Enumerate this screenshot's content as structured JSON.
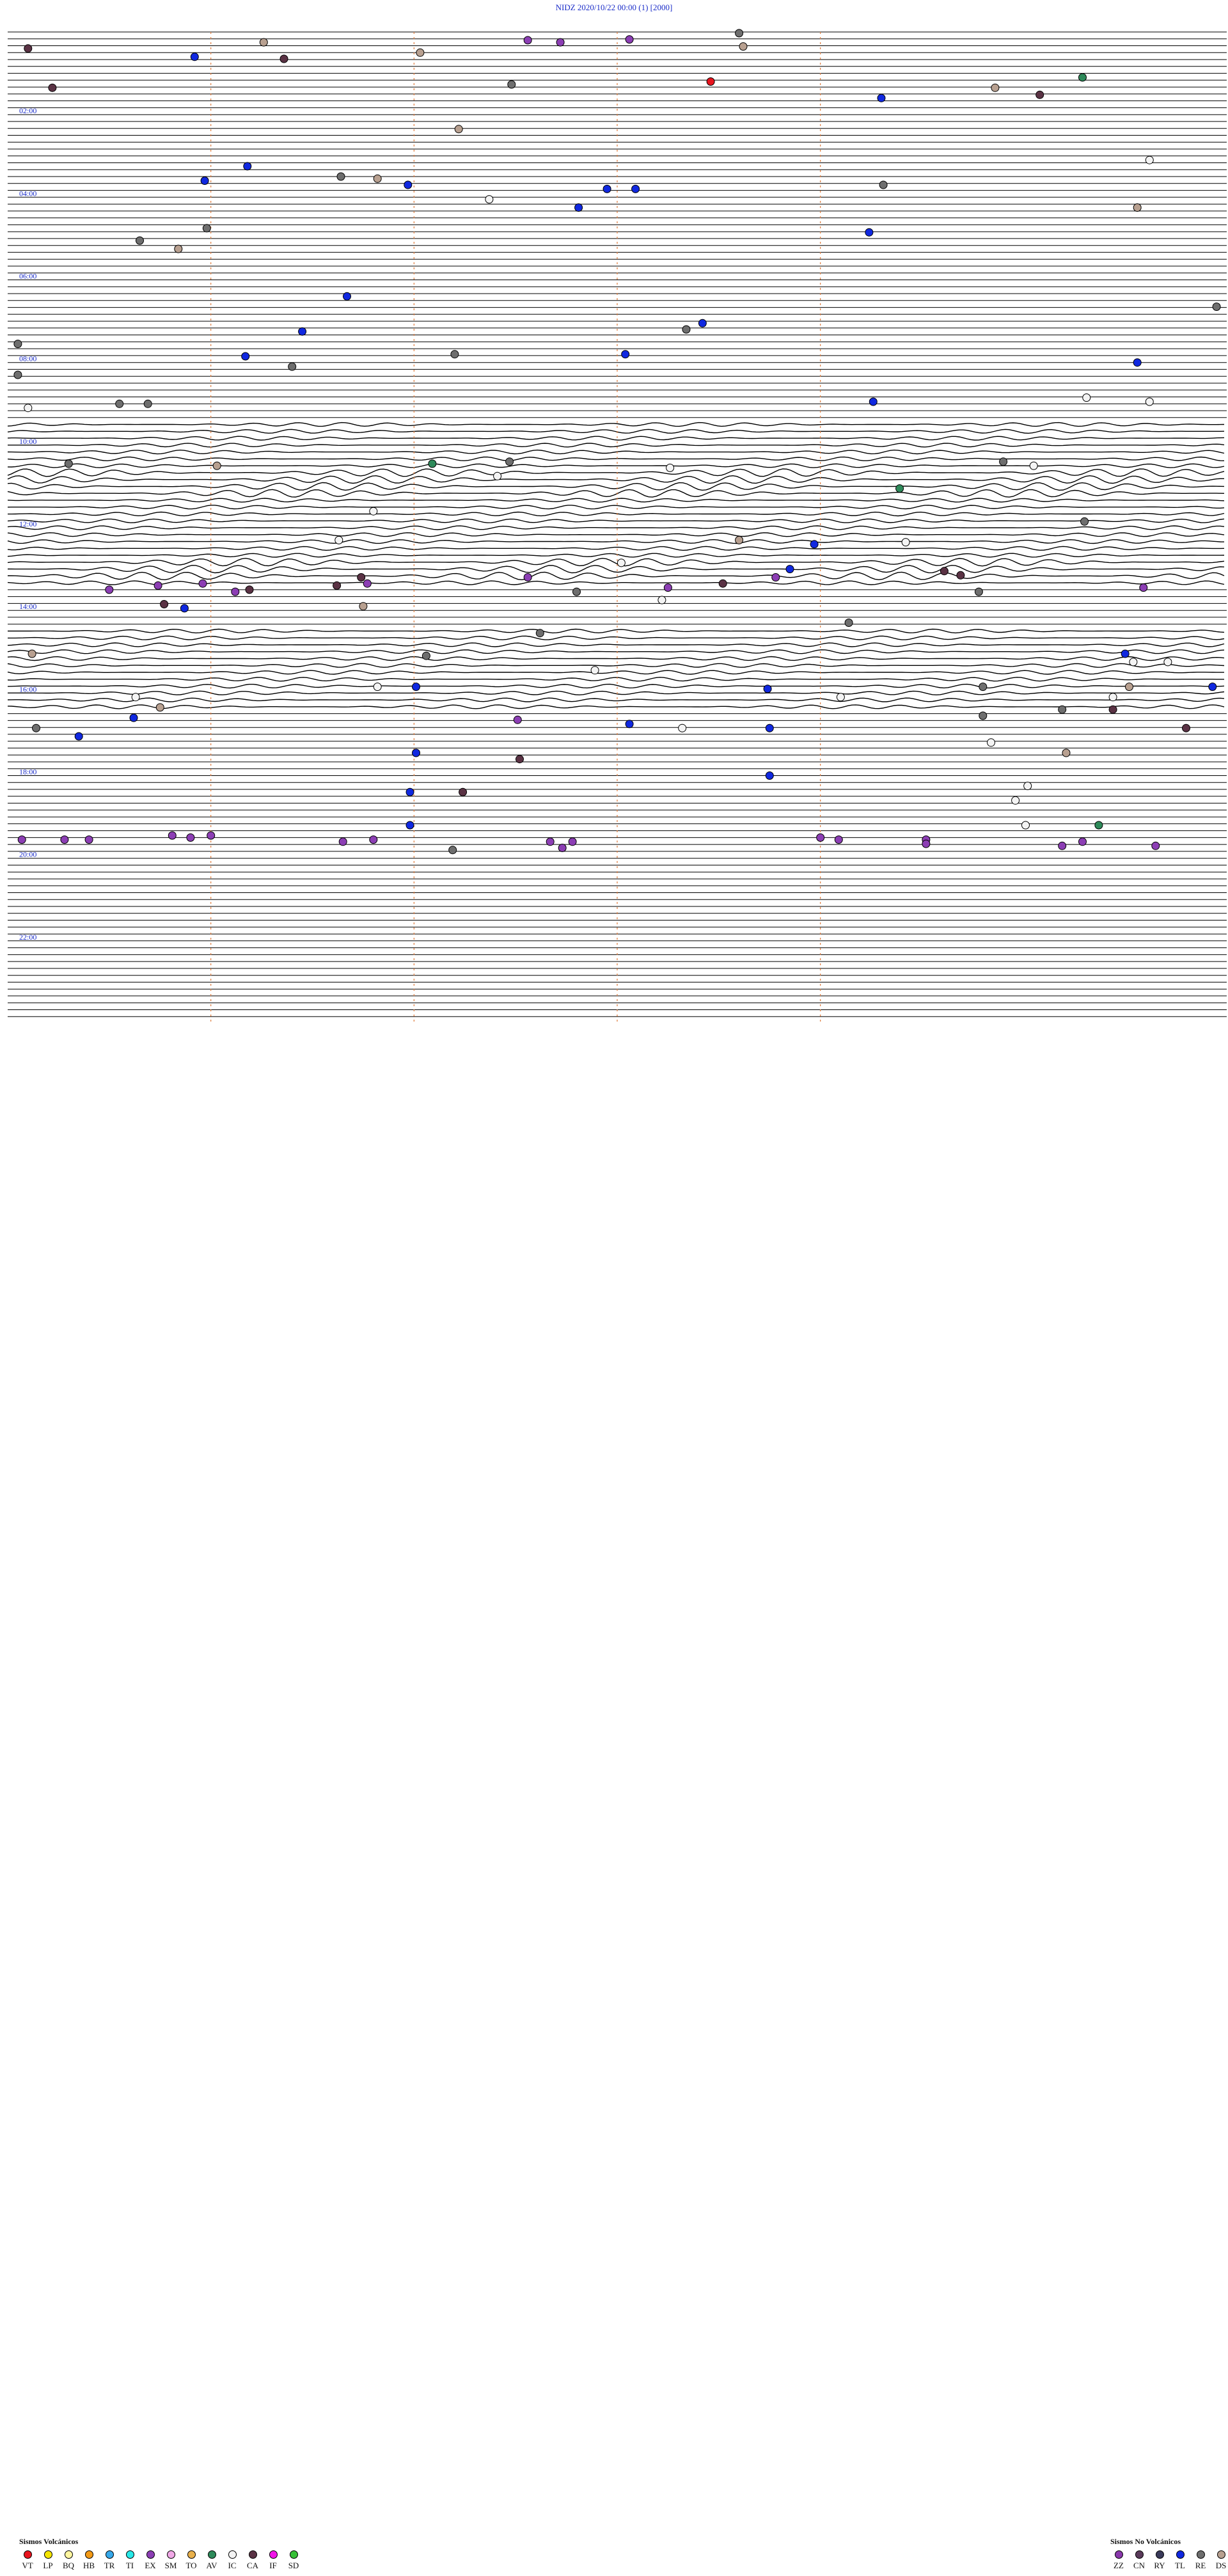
{
  "header": {
    "title": "NIDZ    2020/10/22 00:00      (1)   [2000]"
  },
  "chart_data": {
    "type": "scatter",
    "title": "NIDZ    2020/10/22 00:00      (1)   [2000]",
    "station": "NIDZ",
    "date": "2020/10/22 00:00",
    "hour_labels": [
      "02:00",
      "04:00",
      "06:00",
      "08:00",
      "10:00",
      "12:00",
      "14:00",
      "16:00",
      "18:00",
      "20:00",
      "22:00"
    ],
    "x_range_minutes": [
      0,
      60
    ],
    "y_range_hours": [
      0,
      24
    ],
    "trace_lines_per_hour": 6,
    "minute_dividers": [
      10,
      20,
      30,
      40
    ],
    "colors": {
      "VT": "#e8141e",
      "LP": "#f4e400",
      "BQ": "#fff6a0",
      "HB": "#f39a16",
      "TR": "#36a8ea",
      "TI": "#28e8e8",
      "EX": "#8c3eb4",
      "SM": "#f0a8e6",
      "TO": "#e8b04c",
      "AV": "#2e8a5a",
      "IC": "#f4f4f4",
      "CA": "#5a3244",
      "IF": "#f014e8",
      "SD": "#38c038",
      "ZZ": "#8a38ac",
      "CN": "#5a3a5a",
      "RY": "#3a3a5a",
      "TL": "#1028e0",
      "RE": "#6e6e6e",
      "DS": "#b8a090",
      "trace": "#000000",
      "divider": "#e07c3c",
      "label": "#1a2cc8"
    },
    "legend_volcanic": {
      "title": "Sismos Volcánicos",
      "items": [
        "VT",
        "LP",
        "BQ",
        "HB",
        "TR",
        "TI",
        "EX",
        "SM",
        "TO",
        "AV",
        "IC",
        "CA",
        "IF",
        "SD"
      ]
    },
    "legend_non_volcanic": {
      "title": "Sismos No Volcánicos",
      "items": [
        "ZZ",
        "CN",
        "RY",
        "TL",
        "RE",
        "DS"
      ]
    },
    "events": [
      {
        "minute": 1.0,
        "hour": 0.4,
        "type": "CA"
      },
      {
        "minute": 12.6,
        "hour": 0.25,
        "type": "DS"
      },
      {
        "minute": 9.2,
        "hour": 0.6,
        "type": "TL"
      },
      {
        "minute": 13.6,
        "hour": 0.65,
        "type": "CA"
      },
      {
        "minute": 20.3,
        "hour": 0.5,
        "type": "DS"
      },
      {
        "minute": 25.6,
        "hour": 0.2,
        "type": "EX"
      },
      {
        "minute": 27.2,
        "hour": 0.25,
        "type": "EX"
      },
      {
        "minute": 30.6,
        "hour": 0.18,
        "type": "EX"
      },
      {
        "minute": 36.0,
        "hour": 0.03,
        "type": "RE"
      },
      {
        "minute": 36.2,
        "hour": 0.35,
        "type": "DS"
      },
      {
        "minute": 34.6,
        "hour": 1.2,
        "type": "VT"
      },
      {
        "minute": 24.8,
        "hour": 1.27,
        "type": "RE"
      },
      {
        "minute": 2.2,
        "hour": 1.35,
        "type": "CA"
      },
      {
        "minute": 43.0,
        "hour": 1.6,
        "type": "TL"
      },
      {
        "minute": 48.6,
        "hour": 1.35,
        "type": "DS"
      },
      {
        "minute": 50.8,
        "hour": 1.52,
        "type": "CA"
      },
      {
        "minute": 52.9,
        "hour": 1.1,
        "type": "AV"
      },
      {
        "minute": 22.2,
        "hour": 2.35,
        "type": "DS"
      },
      {
        "minute": 11.8,
        "hour": 3.25,
        "type": "TL"
      },
      {
        "minute": 16.4,
        "hour": 3.5,
        "type": "RE"
      },
      {
        "minute": 18.2,
        "hour": 3.55,
        "type": "DS"
      },
      {
        "minute": 9.7,
        "hour": 3.6,
        "type": "TL"
      },
      {
        "minute": 19.7,
        "hour": 3.7,
        "type": "TL"
      },
      {
        "minute": 29.5,
        "hour": 3.8,
        "type": "TL"
      },
      {
        "minute": 30.9,
        "hour": 3.8,
        "type": "TL"
      },
      {
        "minute": 43.1,
        "hour": 3.7,
        "type": "RE"
      },
      {
        "minute": 56.2,
        "hour": 3.1,
        "type": "IC"
      },
      {
        "minute": 23.7,
        "hour": 4.05,
        "type": "IC"
      },
      {
        "minute": 28.1,
        "hour": 4.25,
        "type": "TL"
      },
      {
        "minute": 55.6,
        "hour": 4.25,
        "type": "DS"
      },
      {
        "minute": 9.8,
        "hour": 4.75,
        "type": "RE"
      },
      {
        "minute": 6.5,
        "hour": 5.05,
        "type": "RE"
      },
      {
        "minute": 8.4,
        "hour": 5.25,
        "type": "DS"
      },
      {
        "minute": 42.4,
        "hour": 4.85,
        "type": "TL"
      },
      {
        "minute": 16.7,
        "hour": 6.4,
        "type": "TL"
      },
      {
        "minute": 59.5,
        "hour": 6.65,
        "type": "RE"
      },
      {
        "minute": 34.2,
        "hour": 7.05,
        "type": "TL"
      },
      {
        "minute": 14.5,
        "hour": 7.25,
        "type": "TL"
      },
      {
        "minute": 33.4,
        "hour": 7.2,
        "type": "RE"
      },
      {
        "minute": 0.5,
        "hour": 7.55,
        "type": "RE"
      },
      {
        "minute": 22.0,
        "hour": 7.8,
        "type": "RE"
      },
      {
        "minute": 11.7,
        "hour": 7.85,
        "type": "TL"
      },
      {
        "minute": 14.0,
        "hour": 8.1,
        "type": "RE"
      },
      {
        "minute": 30.4,
        "hour": 7.8,
        "type": "TL"
      },
      {
        "minute": 55.6,
        "hour": 8.0,
        "type": "TL"
      },
      {
        "minute": 0.5,
        "hour": 8.3,
        "type": "RE"
      },
      {
        "minute": 1.0,
        "hour": 9.1,
        "type": "IC"
      },
      {
        "minute": 42.6,
        "hour": 8.95,
        "type": "TL"
      },
      {
        "minute": 53.1,
        "hour": 8.85,
        "type": "IC"
      },
      {
        "minute": 56.2,
        "hour": 8.95,
        "type": "IC"
      },
      {
        "minute": 5.5,
        "hour": 9.0,
        "type": "RE"
      },
      {
        "minute": 6.9,
        "hour": 9.0,
        "type": "RE"
      },
      {
        "minute": 3.0,
        "hour": 10.45,
        "type": "RE"
      },
      {
        "minute": 10.3,
        "hour": 10.5,
        "type": "DS"
      },
      {
        "minute": 20.9,
        "hour": 10.45,
        "type": "AV"
      },
      {
        "minute": 24.7,
        "hour": 10.4,
        "type": "RE"
      },
      {
        "minute": 24.1,
        "hour": 10.75,
        "type": "IC"
      },
      {
        "minute": 32.6,
        "hour": 10.55,
        "type": "IC"
      },
      {
        "minute": 49.0,
        "hour": 10.4,
        "type": "RE"
      },
      {
        "minute": 50.5,
        "hour": 10.5,
        "type": "IC"
      },
      {
        "minute": 43.9,
        "hour": 11.05,
        "type": "AV"
      },
      {
        "minute": 18.0,
        "hour": 11.6,
        "type": "IC"
      },
      {
        "minute": 53.0,
        "hour": 11.85,
        "type": "RE"
      },
      {
        "minute": 16.3,
        "hour": 12.3,
        "type": "IC"
      },
      {
        "minute": 36.0,
        "hour": 12.3,
        "type": "DS"
      },
      {
        "minute": 39.7,
        "hour": 12.4,
        "type": "TL"
      },
      {
        "minute": 44.2,
        "hour": 12.35,
        "type": "IC"
      },
      {
        "minute": 30.2,
        "hour": 12.85,
        "type": "IC"
      },
      {
        "minute": 38.5,
        "hour": 13.0,
        "type": "TL"
      },
      {
        "minute": 17.4,
        "hour": 13.2,
        "type": "CA"
      },
      {
        "minute": 7.4,
        "hour": 13.4,
        "type": "EX"
      },
      {
        "minute": 9.6,
        "hour": 13.35,
        "type": "EX"
      },
      {
        "minute": 16.2,
        "hour": 13.4,
        "type": "CA"
      },
      {
        "minute": 17.7,
        "hour": 13.35,
        "type": "EX"
      },
      {
        "minute": 5.0,
        "hour": 13.5,
        "type": "EX"
      },
      {
        "minute": 11.2,
        "hour": 13.55,
        "type": "EX"
      },
      {
        "minute": 11.9,
        "hour": 13.5,
        "type": "CA"
      },
      {
        "minute": 25.6,
        "hour": 13.2,
        "type": "EX"
      },
      {
        "minute": 28.0,
        "hour": 13.55,
        "type": "RE"
      },
      {
        "minute": 32.5,
        "hour": 13.45,
        "type": "EX"
      },
      {
        "minute": 35.2,
        "hour": 13.35,
        "type": "CA"
      },
      {
        "minute": 37.8,
        "hour": 13.2,
        "type": "EX"
      },
      {
        "minute": 46.1,
        "hour": 13.05,
        "type": "CA"
      },
      {
        "minute": 46.9,
        "hour": 13.15,
        "type": "CA"
      },
      {
        "minute": 47.8,
        "hour": 13.55,
        "type": "RE"
      },
      {
        "minute": 55.9,
        "hour": 13.45,
        "type": "EX"
      },
      {
        "minute": 7.7,
        "hour": 13.85,
        "type": "CA"
      },
      {
        "minute": 8.7,
        "hour": 13.95,
        "type": "TL"
      },
      {
        "minute": 17.5,
        "hour": 13.9,
        "type": "DS"
      },
      {
        "minute": 32.2,
        "hour": 13.75,
        "type": "IC"
      },
      {
        "minute": 41.4,
        "hour": 14.3,
        "type": "RE"
      },
      {
        "minute": 26.2,
        "hour": 14.55,
        "type": "RE"
      },
      {
        "minute": 1.2,
        "hour": 15.05,
        "type": "DS"
      },
      {
        "minute": 20.6,
        "hour": 15.1,
        "type": "RE"
      },
      {
        "minute": 55.0,
        "hour": 15.05,
        "type": "TL"
      },
      {
        "minute": 55.4,
        "hour": 15.25,
        "type": "IC"
      },
      {
        "minute": 57.1,
        "hour": 15.25,
        "type": "IC"
      },
      {
        "minute": 28.9,
        "hour": 15.45,
        "type": "IC"
      },
      {
        "minute": 37.4,
        "hour": 15.9,
        "type": "TL"
      },
      {
        "minute": 18.2,
        "hour": 15.85,
        "type": "IC"
      },
      {
        "minute": 20.1,
        "hour": 15.85,
        "type": "TL"
      },
      {
        "minute": 41.0,
        "hour": 16.1,
        "type": "IC"
      },
      {
        "minute": 48.0,
        "hour": 15.85,
        "type": "RE"
      },
      {
        "minute": 55.2,
        "hour": 15.85,
        "type": "DS"
      },
      {
        "minute": 59.3,
        "hour": 15.85,
        "type": "TL"
      },
      {
        "minute": 54.4,
        "hour": 16.1,
        "type": "IC"
      },
      {
        "minute": 51.9,
        "hour": 16.4,
        "type": "RE"
      },
      {
        "minute": 54.4,
        "hour": 16.4,
        "type": "CA"
      },
      {
        "minute": 6.3,
        "hour": 16.1,
        "type": "IC"
      },
      {
        "minute": 7.5,
        "hour": 16.35,
        "type": "DS"
      },
      {
        "minute": 6.2,
        "hour": 16.6,
        "type": "TL"
      },
      {
        "minute": 48.0,
        "hour": 16.55,
        "type": "RE"
      },
      {
        "minute": 25.1,
        "hour": 16.65,
        "type": "EX"
      },
      {
        "minute": 1.4,
        "hour": 16.85,
        "type": "RE"
      },
      {
        "minute": 30.6,
        "hour": 16.75,
        "type": "TL"
      },
      {
        "minute": 33.2,
        "hour": 16.85,
        "type": "IC"
      },
      {
        "minute": 37.5,
        "hour": 16.85,
        "type": "TL"
      },
      {
        "minute": 58.0,
        "hour": 16.85,
        "type": "CA"
      },
      {
        "minute": 3.5,
        "hour": 17.05,
        "type": "TL"
      },
      {
        "minute": 48.4,
        "hour": 17.2,
        "type": "IC"
      },
      {
        "minute": 52.1,
        "hour": 17.45,
        "type": "DS"
      },
      {
        "minute": 25.2,
        "hour": 17.6,
        "type": "CA"
      },
      {
        "minute": 20.1,
        "hour": 17.45,
        "type": "TL"
      },
      {
        "minute": 37.5,
        "hour": 18.0,
        "type": "TL"
      },
      {
        "minute": 50.2,
        "hour": 18.25,
        "type": "IC"
      },
      {
        "minute": 19.8,
        "hour": 18.4,
        "type": "TL"
      },
      {
        "minute": 22.4,
        "hour": 18.4,
        "type": "CA"
      },
      {
        "minute": 49.6,
        "hour": 18.6,
        "type": "IC"
      },
      {
        "minute": 0.7,
        "hour": 19.55,
        "type": "EX"
      },
      {
        "minute": 2.8,
        "hour": 19.55,
        "type": "EX"
      },
      {
        "minute": 4.0,
        "hour": 19.55,
        "type": "EX"
      },
      {
        "minute": 8.1,
        "hour": 19.45,
        "type": "EX"
      },
      {
        "minute": 9.0,
        "hour": 19.5,
        "type": "EX"
      },
      {
        "minute": 10.0,
        "hour": 19.45,
        "type": "EX"
      },
      {
        "minute": 16.5,
        "hour": 19.6,
        "type": "EX"
      },
      {
        "minute": 18.0,
        "hour": 19.55,
        "type": "EX"
      },
      {
        "minute": 19.8,
        "hour": 19.2,
        "type": "TL"
      },
      {
        "minute": 21.9,
        "hour": 19.8,
        "type": "RE"
      },
      {
        "minute": 26.7,
        "hour": 19.6,
        "type": "EX"
      },
      {
        "minute": 27.8,
        "hour": 19.6,
        "type": "EX"
      },
      {
        "minute": 27.3,
        "hour": 19.75,
        "type": "EX"
      },
      {
        "minute": 40.0,
        "hour": 19.5,
        "type": "EX"
      },
      {
        "minute": 40.9,
        "hour": 19.55,
        "type": "EX"
      },
      {
        "minute": 45.2,
        "hour": 19.55,
        "type": "EX"
      },
      {
        "minute": 45.2,
        "hour": 19.65,
        "type": "EX"
      },
      {
        "minute": 50.1,
        "hour": 19.2,
        "type": "IC"
      },
      {
        "minute": 53.7,
        "hour": 19.2,
        "type": "AV"
      },
      {
        "minute": 51.9,
        "hour": 19.7,
        "type": "EX"
      },
      {
        "minute": 52.9,
        "hour": 19.6,
        "type": "EX"
      },
      {
        "minute": 56.5,
        "hour": 19.7,
        "type": "EX"
      }
    ]
  }
}
